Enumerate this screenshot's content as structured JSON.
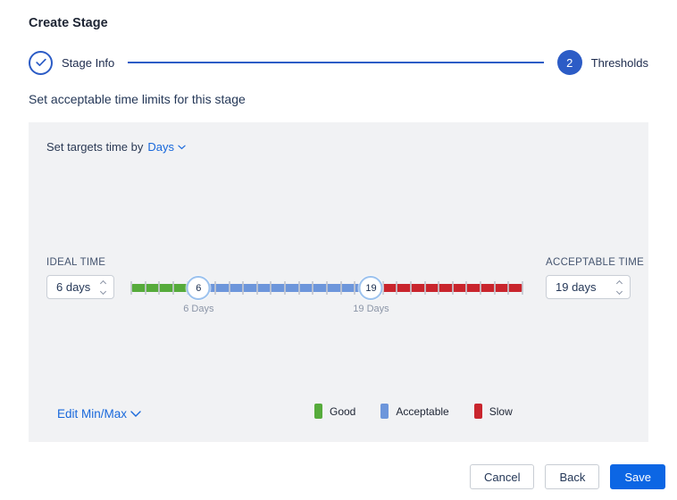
{
  "colors": {
    "good": "#56ab3b",
    "acceptable": "#6d96db",
    "slow": "#c9252d",
    "link": "#1868db",
    "primary": "#0c66e4",
    "step": "#2c5cc6",
    "handle_border": "#9cc2ee"
  },
  "page": {
    "title": "Create Stage"
  },
  "stepper": {
    "steps": [
      {
        "label": "Stage Info",
        "state": "complete"
      },
      {
        "label": "Thresholds",
        "state": "current",
        "number": "2"
      }
    ]
  },
  "subtitle": "Set acceptable time limits for this stage",
  "panel": {
    "target_time_prefix": "Set targets time by",
    "target_time_unit": "Days",
    "ideal": {
      "label": "IDEAL TIME",
      "value": "6 days"
    },
    "acceptable": {
      "label": "ACCEPTABLE TIME",
      "value": "19 days"
    },
    "slider": {
      "handle1": {
        "value": "6",
        "label": "6 Days",
        "percent": 17.2
      },
      "handle2": {
        "value": "19",
        "label": "19 Days",
        "percent": 61.3
      },
      "tick_count": 28
    },
    "edit_minmax_label": "Edit Min/Max",
    "legend": [
      {
        "label": "Good",
        "color": "#56ab3b"
      },
      {
        "label": "Acceptable",
        "color": "#6d96db"
      },
      {
        "label": "Slow",
        "color": "#c9252d"
      }
    ]
  },
  "footer": {
    "cancel_label": "Cancel",
    "back_label": "Back",
    "save_label": "Save"
  }
}
